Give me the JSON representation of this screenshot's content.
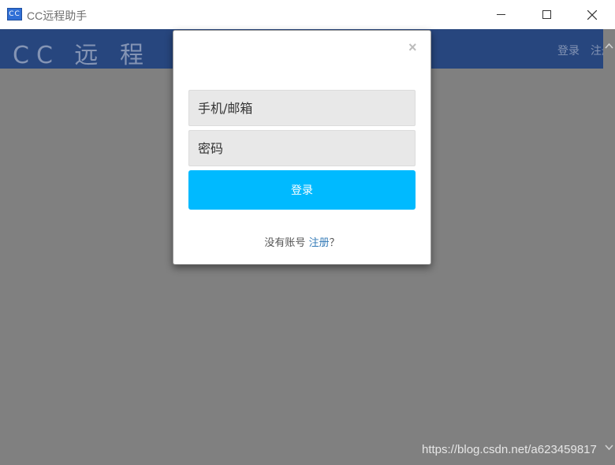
{
  "window": {
    "icon_text": "CC",
    "title": "CC远程助手"
  },
  "header": {
    "brand": "CC 远 程",
    "nav_login": "登录",
    "nav_register": "注册"
  },
  "modal": {
    "close_symbol": "×",
    "account_placeholder": "手机/邮箱",
    "password_placeholder": "密码",
    "login_button": "登录",
    "footer_prefix": "没有账号",
    "footer_link": "注册",
    "footer_suffix": "？"
  },
  "watermark": "https://blog.csdn.net/a623459817"
}
